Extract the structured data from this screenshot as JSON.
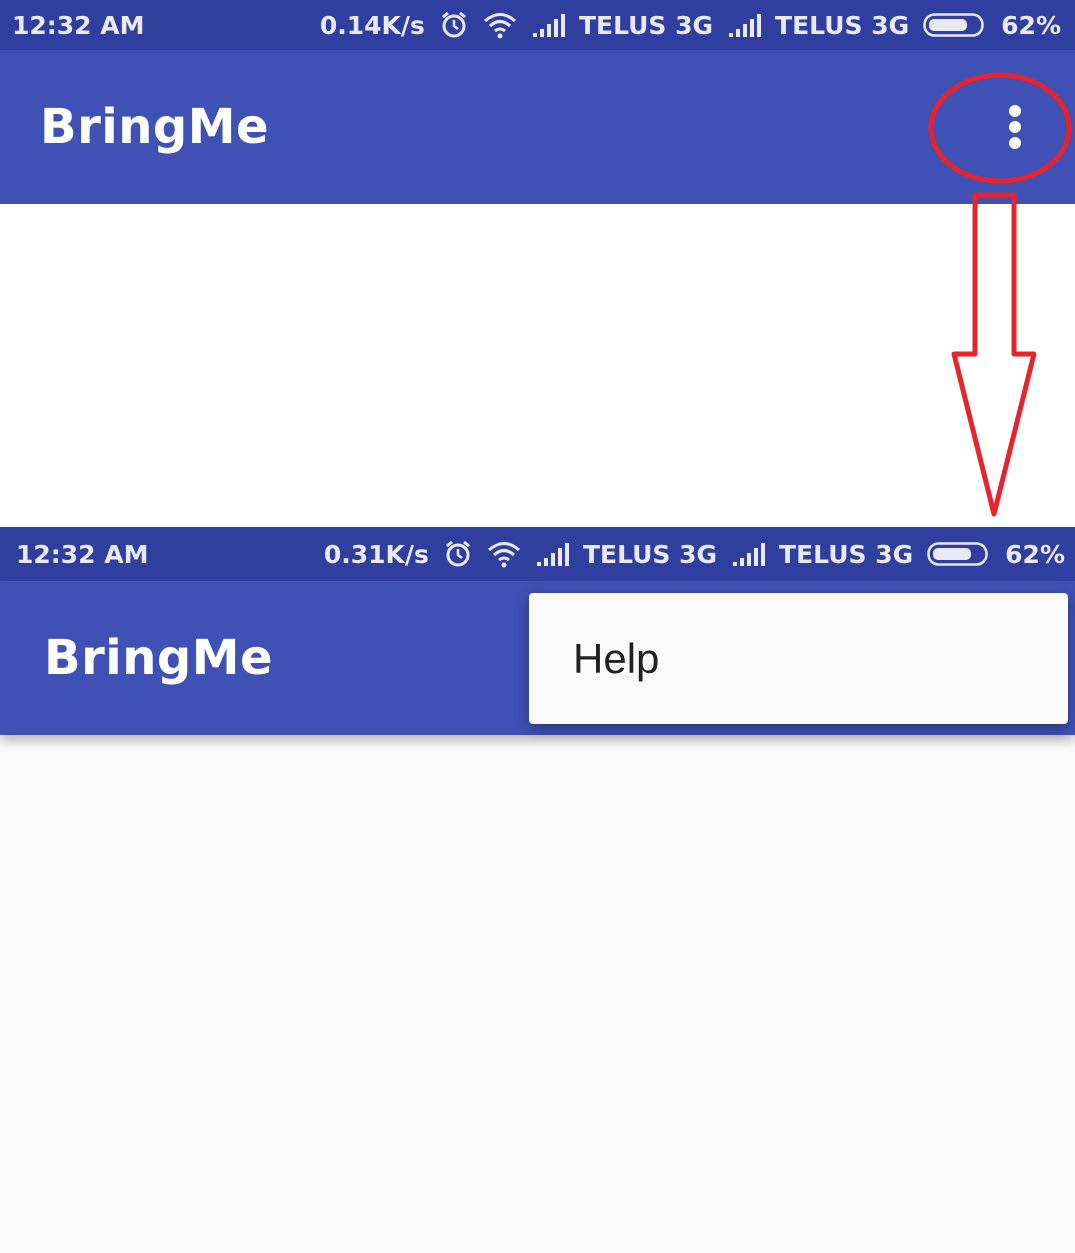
{
  "screen_before": {
    "status": {
      "time": "12:32 AM",
      "speed": "0.14K/s",
      "carrier1": "TELUS 3G",
      "carrier2": "TELUS 3G",
      "battery": "62%"
    },
    "appbar": {
      "title": "BringMe"
    }
  },
  "screen_after": {
    "status": {
      "time": "12:32 AM",
      "speed": "0.31K/s",
      "carrier1": "TELUS 3G",
      "carrier2": "TELUS 3G",
      "battery": "62%"
    },
    "appbar": {
      "title": "BringMe"
    },
    "menu": {
      "items": [
        {
          "label": "Help"
        }
      ]
    }
  },
  "colors": {
    "statusbar": "#303f9f",
    "appbar": "#3f51b5",
    "annotation": "#e8242a",
    "background": "#fafafa"
  },
  "icons": [
    "alarm-icon",
    "wifi-icon",
    "signal-icon",
    "battery-icon",
    "more-vert-icon"
  ]
}
